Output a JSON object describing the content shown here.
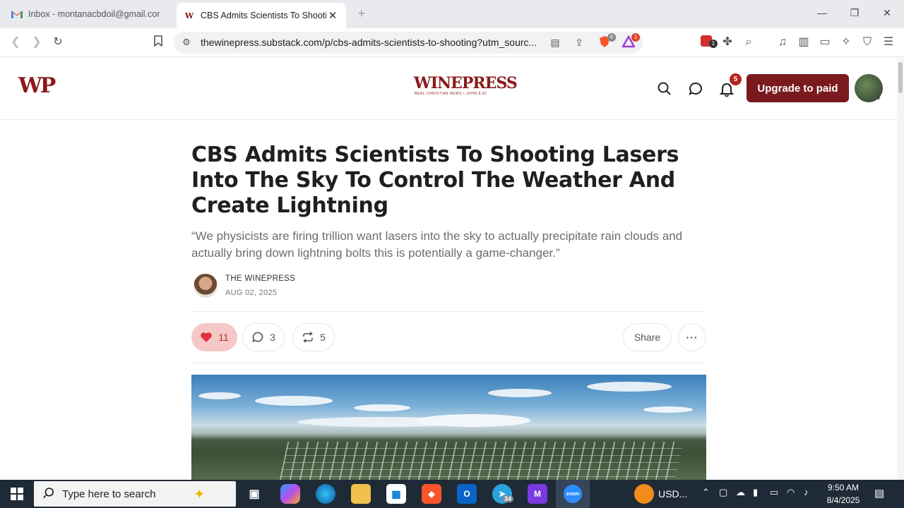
{
  "browser": {
    "tabs": [
      {
        "title": "Inbox - montanacbdoil@gmail.com",
        "icon": "gmail-icon",
        "active": false
      },
      {
        "title": "CBS Admits Scientists To Shooting",
        "icon": "winepress-favicon",
        "active": true
      }
    ],
    "url": "thewinepress.substack.com/p/cbs-admits-scientists-to-shooting?utm_sourc...",
    "brave_shield_count": "6",
    "rewards_count": "1",
    "extension_badge": "1"
  },
  "site": {
    "logo_text": "WP",
    "brand_name": "WINEPRESS",
    "brand_tagline": "REAL CHRISTIAN NEWS • JOHN 8:32",
    "notification_count": "5",
    "upgrade_label": "Upgrade to paid"
  },
  "article": {
    "title": "CBS Admits Scientists To Shooting Lasers Into The Sky To Control The Weather And Create Lightning",
    "subtitle": "“We physicists are firing trillion want lasers into the sky to actually precipitate rain clouds and actually bring down lightning bolts this is potentially a game-changer.”",
    "author": "THE WINEPRESS",
    "date": "AUG 02, 2025",
    "likes": "11",
    "comments": "3",
    "restacks": "5",
    "share_label": "Share"
  },
  "taskbar": {
    "search_placeholder": "Type here to search",
    "telegram_badge": "34",
    "ticker": "USD...",
    "time": "9:50 AM",
    "date": "8/4/2025"
  },
  "colors": {
    "brand": "#7a1a1e",
    "like_bg": "#f6c7c7",
    "tabstrip": "#e9eaee",
    "taskbar": "#1f2a37"
  }
}
